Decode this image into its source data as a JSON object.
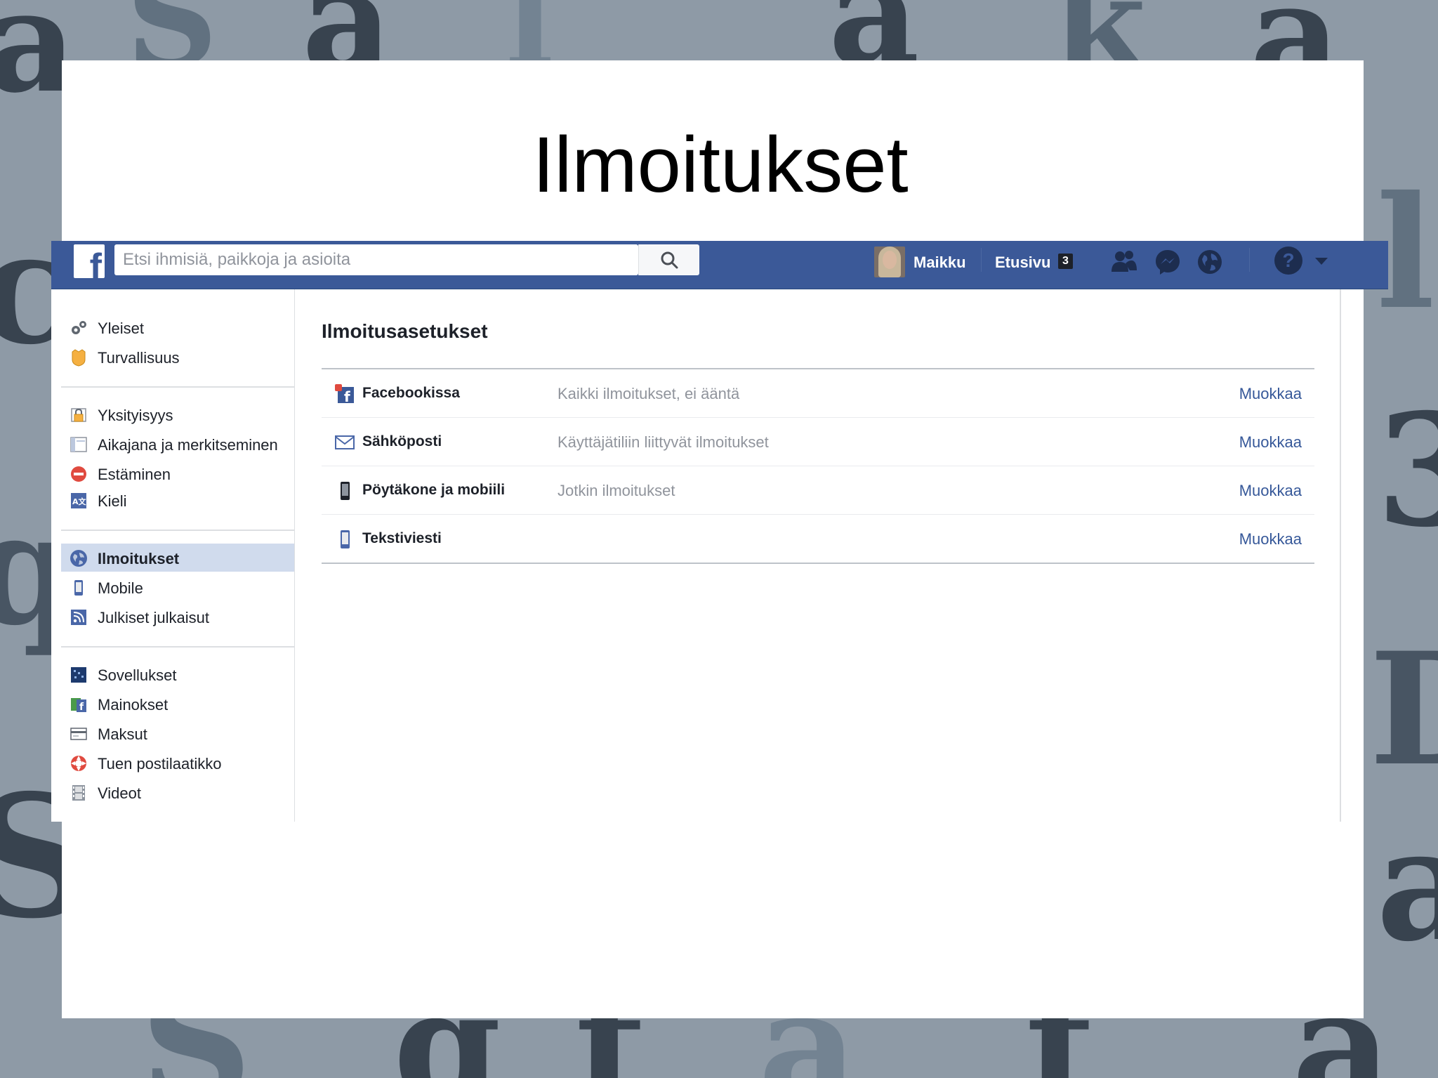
{
  "slide": {
    "title": "Ilmoitukset"
  },
  "topbar": {
    "search_placeholder": "Etsi ihmisiä, paikkoja ja asioita",
    "user_name": "Maikku",
    "home_label": "Etusivu",
    "home_badge": "3",
    "brand_color": "#3b5998"
  },
  "sidebar": {
    "items": [
      {
        "label": "Yleiset",
        "icon": "gears-icon"
      },
      {
        "label": "Turvallisuus",
        "icon": "badge-icon"
      },
      {
        "label": "Yksityisyys",
        "icon": "lock-icon"
      },
      {
        "label": "Aikajana ja merkitseminen",
        "icon": "timeline-icon"
      },
      {
        "label": "Estäminen",
        "icon": "block-icon"
      },
      {
        "label": "Kieli",
        "icon": "language-icon"
      },
      {
        "label": "Ilmoitukset",
        "icon": "globe-icon"
      },
      {
        "label": "Mobile",
        "icon": "phone-icon"
      },
      {
        "label": "Julkiset julkaisut",
        "icon": "rss-icon"
      },
      {
        "label": "Sovellukset",
        "icon": "apps-icon"
      },
      {
        "label": "Mainokset",
        "icon": "ads-icon"
      },
      {
        "label": "Maksut",
        "icon": "card-icon"
      },
      {
        "label": "Tuen postilaatikko",
        "icon": "lifebuoy-icon"
      },
      {
        "label": "Videot",
        "icon": "film-icon"
      }
    ],
    "active_index": 6
  },
  "main": {
    "title": "Ilmoitusasetukset",
    "rows": [
      {
        "name": "Facebookissa",
        "desc": "Kaikki ilmoitukset, ei ääntä",
        "edit": "Muokkaa"
      },
      {
        "name": "Sähköposti",
        "desc": "Käyttäjätiliin liittyvät ilmoitukset",
        "edit": "Muokkaa"
      },
      {
        "name": "Pöytäkone ja mobiili",
        "desc": "Jotkin ilmoitukset",
        "edit": "Muokkaa"
      },
      {
        "name": "Tekstiviesti",
        "desc": "",
        "edit": "Muokkaa"
      }
    ]
  }
}
